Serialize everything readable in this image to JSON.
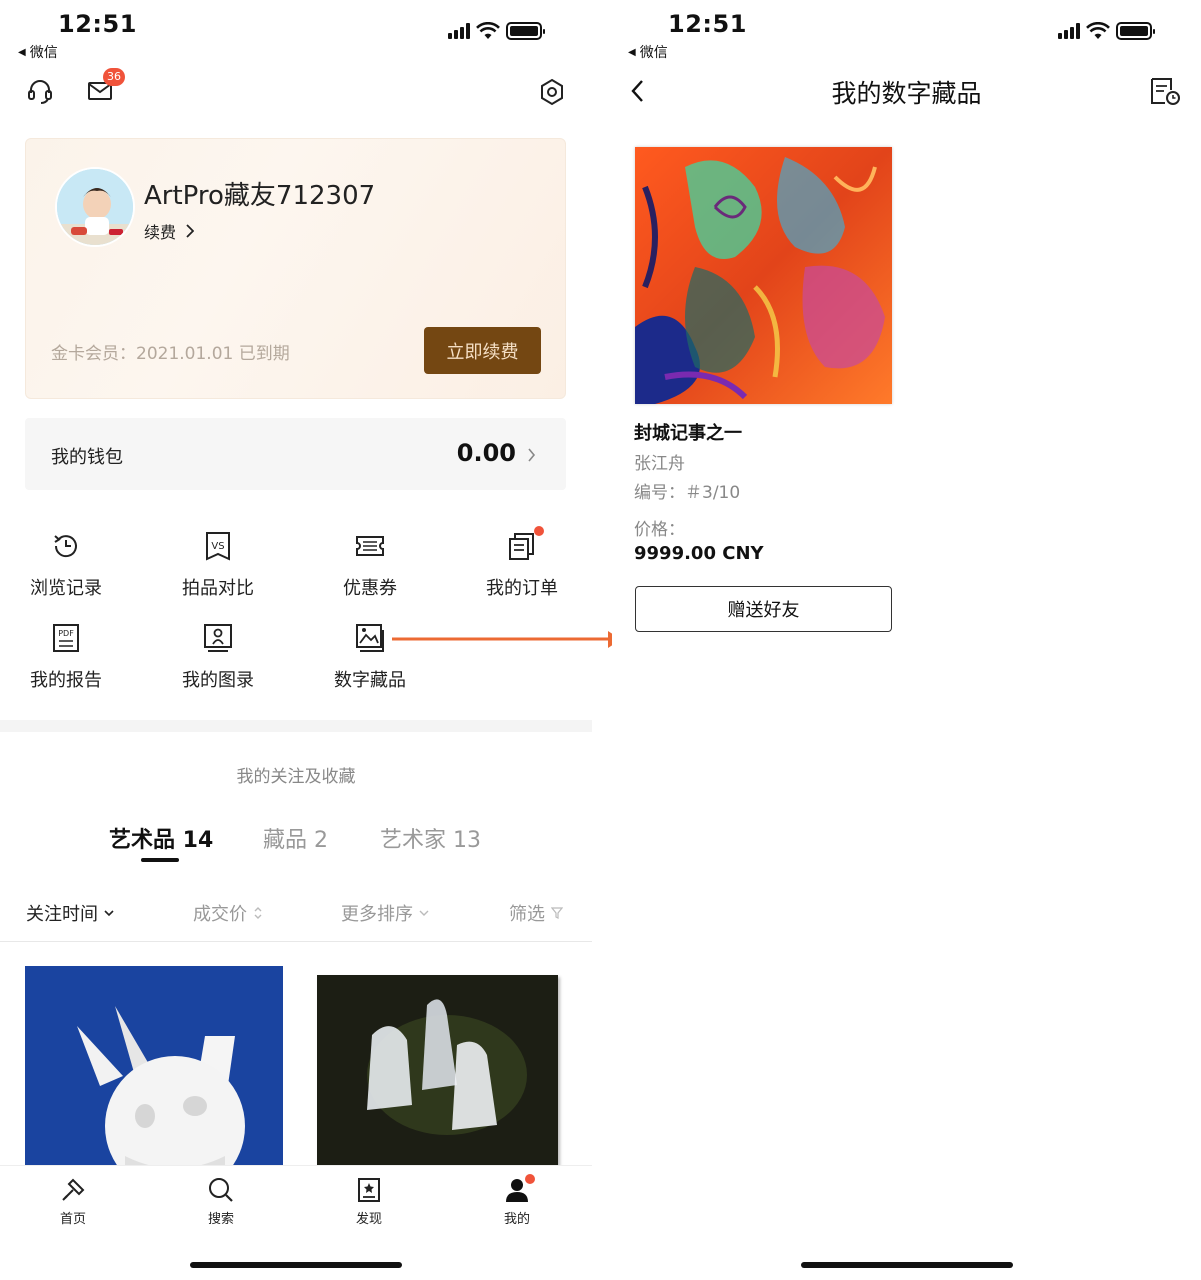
{
  "left": {
    "status": {
      "time": "12:51",
      "back_app": "微信"
    },
    "mail_badge": "36",
    "profile": {
      "username": "ArtPro藏友712307",
      "renew_link": "续费"
    },
    "membership": {
      "status": "金卡会员：2021.01.01 已到期",
      "renew_button": "立即续费"
    },
    "wallet": {
      "label": "我的钱包",
      "value": "0.00"
    },
    "grid": [
      {
        "label": "浏览记录",
        "icon": "history-icon"
      },
      {
        "label": "拍品对比",
        "icon": "compare-icon"
      },
      {
        "label": "优惠券",
        "icon": "coupon-icon"
      },
      {
        "label": "我的订单",
        "icon": "orders-icon"
      },
      {
        "label": "我的报告",
        "icon": "pdf-report-icon"
      },
      {
        "label": "我的图录",
        "icon": "catalog-icon"
      },
      {
        "label": "数字藏品",
        "icon": "digital-collection-icon"
      }
    ],
    "follow_title": "我的关注及收藏",
    "tabs": [
      "艺术品 14",
      "藏品 2",
      "艺术家 13"
    ],
    "sort": [
      "关注时间",
      "成交价",
      "更多排序",
      "筛选"
    ],
    "tabbar": [
      {
        "label": "首页",
        "icon": "home-icon"
      },
      {
        "label": "搜索",
        "icon": "search-icon"
      },
      {
        "label": "发现",
        "icon": "discover-icon"
      },
      {
        "label": "我的",
        "icon": "profile-icon"
      }
    ]
  },
  "right": {
    "status": {
      "time": "12:51",
      "back_app": "微信"
    },
    "title": "我的数字藏品",
    "item": {
      "title": "封城记事之一",
      "artist": "张江舟",
      "edition": "编号：＃3/10",
      "price_label": "价格：",
      "price": "9999.00 CNY",
      "gift_button": "赠送好友"
    }
  },
  "colors": {
    "accent": "#f0533a",
    "renew_button_bg": "#744712",
    "arrow": "#ec6a33"
  }
}
